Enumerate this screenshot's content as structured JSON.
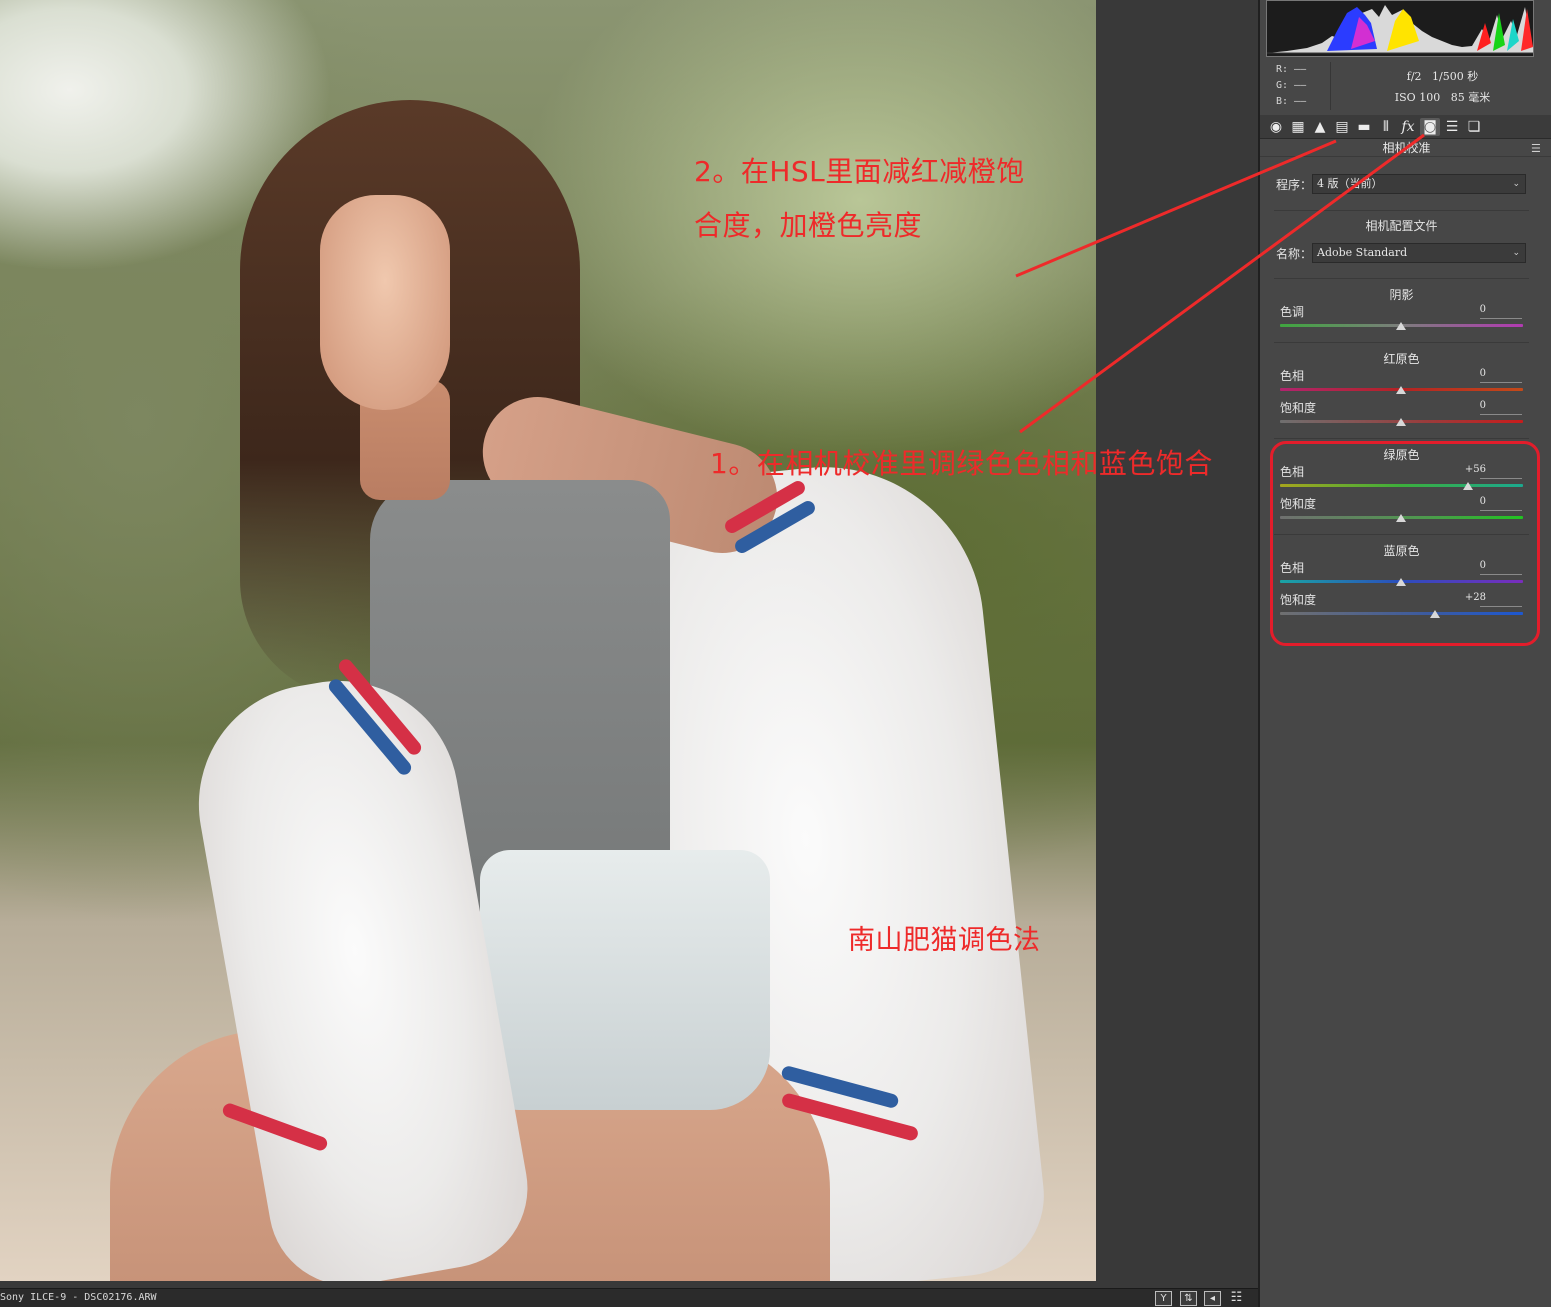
{
  "annotations": {
    "step2_line1": "2。在HSL里面减红减橙饱",
    "step2_line2": "合度，加橙色亮度",
    "step1": "1。在相机校准里调绿色色相和蓝色饱合",
    "signature": "南山肥猫调色法",
    "color": "#ee2a2a"
  },
  "statusbar": {
    "file": "Sony ILCE-9 -  DSC02176.ARW",
    "icons": [
      "Y",
      "swap-icon",
      "left-arrow-icon",
      "prefs-icon"
    ]
  },
  "histogram": {
    "readout": {
      "r": "R:  ——",
      "g": "G:  ——",
      "b": "B:  ——"
    }
  },
  "exif": {
    "aperture": "f/2",
    "shutter": "1/500 秒",
    "iso": "ISO 100",
    "focal": "85 毫米"
  },
  "tabs": [
    {
      "name": "basic-icon",
      "glyph": "◉"
    },
    {
      "name": "tone-curve-icon",
      "glyph": "▦"
    },
    {
      "name": "detail-icon",
      "glyph": "▲"
    },
    {
      "name": "hsl-icon",
      "glyph": "▤"
    },
    {
      "name": "split-toning-icon",
      "glyph": "▬"
    },
    {
      "name": "lens-icon",
      "glyph": "⦀"
    },
    {
      "name": "fx-icon",
      "glyph": "fx"
    },
    {
      "name": "camera-calibration-icon",
      "glyph": "◙"
    },
    {
      "name": "presets-icon",
      "glyph": "☰"
    },
    {
      "name": "snapshots-icon",
      "glyph": "❏"
    }
  ],
  "panel": {
    "section_title": "相机校准",
    "process_label": "程序：",
    "process_value": "4 版（当前）",
    "profile_heading": "相机配置文件",
    "name_label": "名称：",
    "name_value": "Adobe Standard",
    "groups": {
      "shadows": {
        "title": "阴影",
        "sliders": [
          {
            "label": "色调",
            "value": "0"
          }
        ]
      },
      "red": {
        "title": "红原色",
        "sliders": [
          {
            "label": "色相",
            "value": "0"
          },
          {
            "label": "饱和度",
            "value": "0"
          }
        ]
      },
      "green": {
        "title": "绿原色",
        "sliders": [
          {
            "label": "色相",
            "value": "+56"
          },
          {
            "label": "饱和度",
            "value": "0"
          }
        ]
      },
      "blue": {
        "title": "蓝原色",
        "sliders": [
          {
            "label": "色相",
            "value": "0"
          },
          {
            "label": "饱和度",
            "value": "+28"
          }
        ]
      }
    },
    "highlight_color": "#e31d2b"
  }
}
